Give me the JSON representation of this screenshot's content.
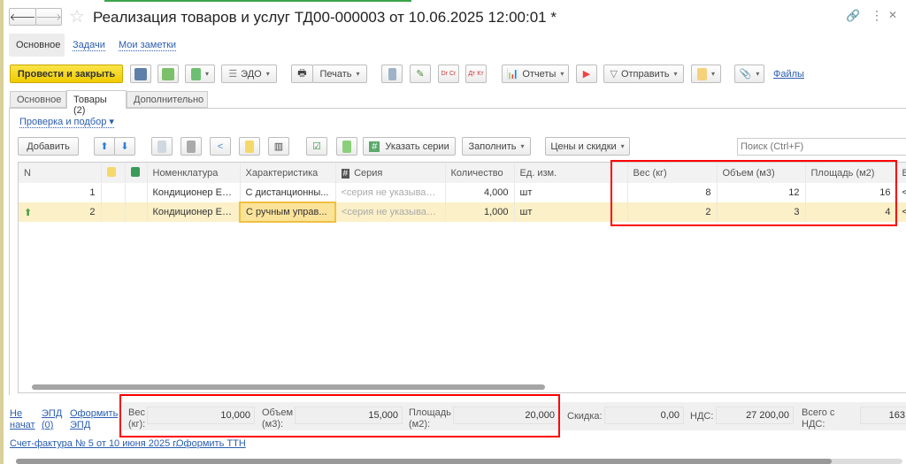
{
  "window": {
    "title": "Реализация товаров и услуг ТД00-000003 от 10.06.2025 12:00:01 *"
  },
  "nav": {
    "main": "Основное",
    "tasks": "Задачи",
    "notes": "Мои заметки"
  },
  "toolbar": {
    "post_close": "Провести и закрыть",
    "edo": "ЭДО",
    "print": "Печать",
    "dr_cr": "Dr Cr",
    "dt_kt": "Дт Кт",
    "reports": "Отчеты",
    "send": "Отправить",
    "files": "Файлы"
  },
  "tabs": [
    {
      "label": "Основное"
    },
    {
      "label": "Товары (2)"
    },
    {
      "label": "Дополнительно"
    }
  ],
  "goods": {
    "check_link": "Проверка и подбор",
    "add": "Добавить",
    "series": "Указать серии",
    "fill": "Заполнить",
    "prices": "Цены и скидки",
    "search_placeholder": "Поиск (Ctrl+F)",
    "columns": [
      "N",
      "Номенклатура",
      "Характеристика",
      "Серия",
      "Количество",
      "Ед. изм.",
      "Вес (кг)",
      "Объем (м3)",
      "Площадь (м2)",
      "В"
    ],
    "rows": [
      {
        "n": "1",
        "item": "Кондиционер EL...",
        "char": "С дистанционны...",
        "series": "<серия не указывает...",
        "qty": "4,000",
        "unit": "шт",
        "weight": "8",
        "volume": "12",
        "area": "16",
        "next": "<"
      },
      {
        "n": "2",
        "item": "Кондиционер EL...",
        "char": "С ручным управ...",
        "series": "<серия не указывает...",
        "qty": "1,000",
        "unit": "шт",
        "weight": "2",
        "volume": "3",
        "area": "4",
        "next": "<"
      }
    ]
  },
  "footer": {
    "not_started": "Не начат",
    "epd": "ЭПД (0)",
    "make_epd": "Оформить ЭПД",
    "weight_label": "Вес (кг):",
    "weight": "10,000",
    "volume_label": "Объем (м3):",
    "volume": "15,000",
    "area_label": "Площадь (м2):",
    "area": "20,000",
    "discount_label": "Скидка:",
    "discount": "0,00",
    "vat_label": "НДС:",
    "vat": "27 200,00",
    "total_label": "Всего с НДС:",
    "total": "163",
    "invoice": "Счет-фактура № 5 от 10 июня 2025 г.",
    "ttn": "Оформить ТТН"
  }
}
